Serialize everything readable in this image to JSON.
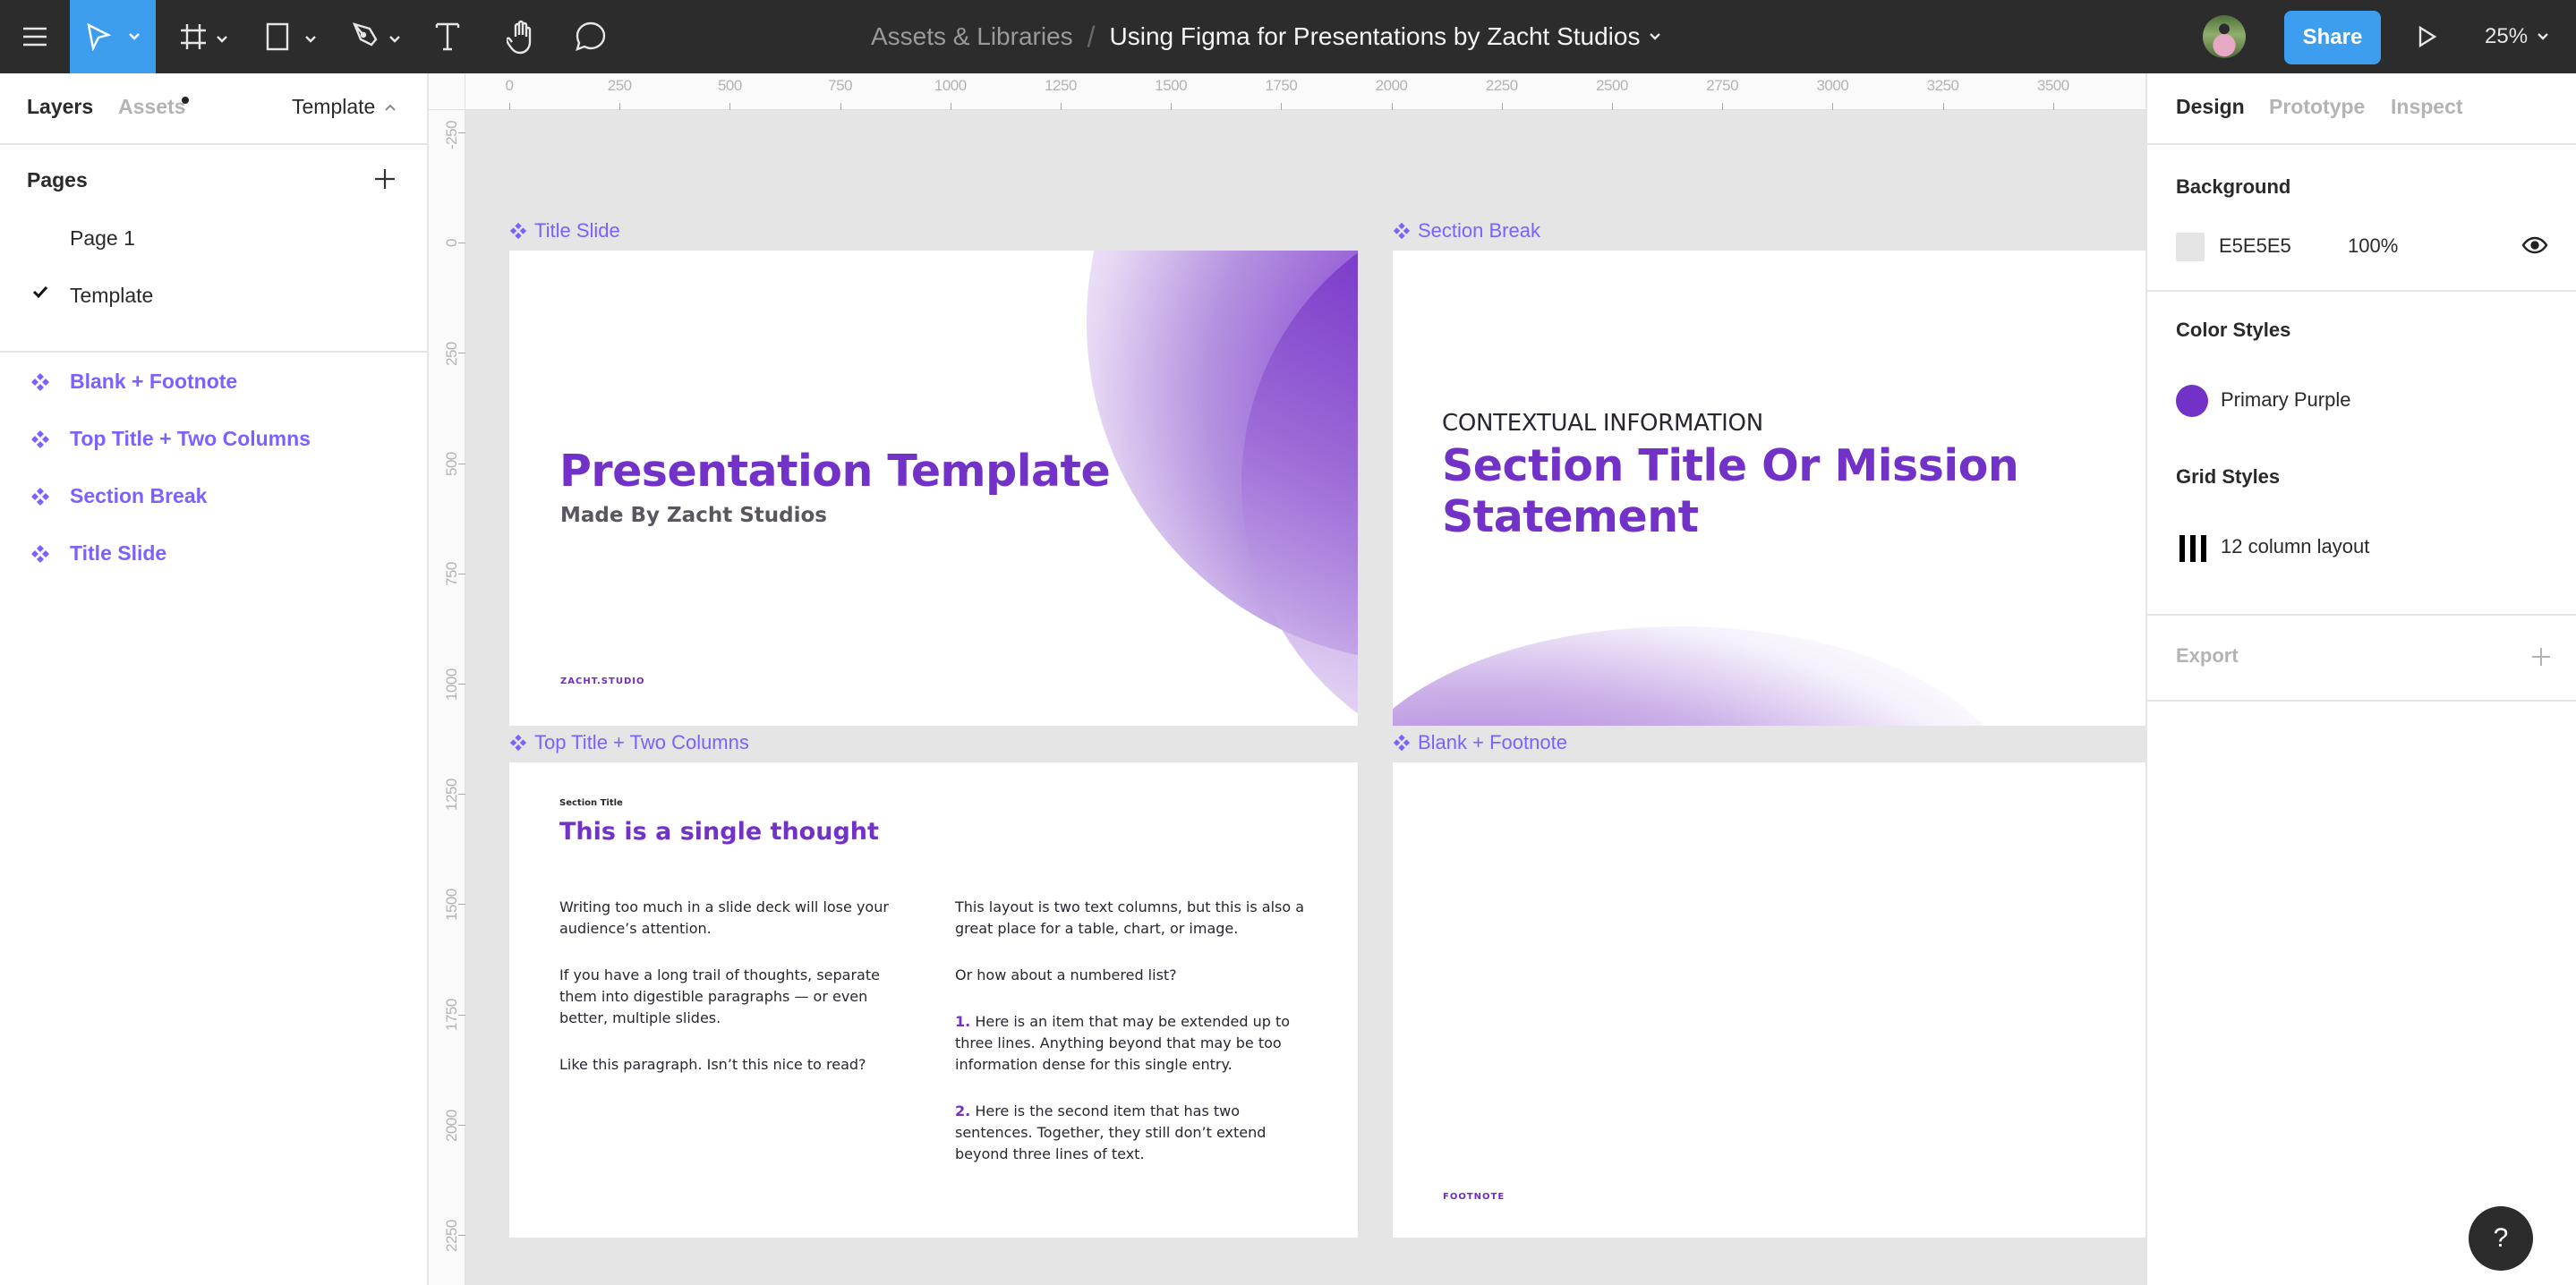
{
  "toolbar": {
    "tools": [
      {
        "name": "main-menu",
        "icon": "hamburger-menu-icon"
      },
      {
        "name": "move-tool",
        "icon": "cursor-arrow-icon",
        "active": true,
        "has_dropdown": true
      },
      {
        "name": "frame-tool",
        "icon": "frame-hash-icon",
        "has_dropdown": true
      },
      {
        "name": "shape-tool",
        "icon": "rectangle-icon",
        "has_dropdown": true
      },
      {
        "name": "pen-tool",
        "icon": "pen-nib-icon",
        "has_dropdown": true
      },
      {
        "name": "text-tool",
        "icon": "text-t-icon"
      },
      {
        "name": "hand-tool",
        "icon": "hand-icon"
      },
      {
        "name": "comment-tool",
        "icon": "speech-bubble-icon"
      }
    ],
    "breadcrumb_parent": "Assets & Libraries",
    "breadcrumb_separator": "/",
    "file_title": "Using Figma for Presentations by Zacht Studios",
    "share_label": "Share",
    "zoom_level": "25%",
    "accent_color": "#3d9ef0"
  },
  "left_panel": {
    "tabs": [
      {
        "label": "Layers",
        "active": true
      },
      {
        "label": "Assets",
        "active": false,
        "has_dot": true
      }
    ],
    "current_page": "Template",
    "pages_header": "Pages",
    "pages": [
      {
        "label": "Page 1",
        "selected": false
      },
      {
        "label": "Template",
        "selected": true
      }
    ],
    "layers": [
      {
        "label": "Blank + Footnote",
        "icon": "component-icon"
      },
      {
        "label": "Top Title + Two Columns",
        "icon": "component-icon"
      },
      {
        "label": "Section Break",
        "icon": "component-icon"
      },
      {
        "label": "Title Slide",
        "icon": "component-icon"
      }
    ],
    "component_color": "#7b61ff"
  },
  "rulers": {
    "top": [
      "0",
      "250",
      "500",
      "750",
      "1000",
      "1250",
      "1500",
      "1750",
      "2000",
      "2250",
      "2500",
      "2750",
      "3000",
      "3250",
      "3500"
    ],
    "left": [
      "-250",
      "0",
      "250",
      "500",
      "750",
      "1000",
      "1250",
      "1500",
      "1750",
      "2000",
      "2250"
    ]
  },
  "canvas": {
    "frames": {
      "title_slide": {
        "label": "Title Slide",
        "title": "Presentation Template",
        "subtitle": "Made By Zacht Studios",
        "footer": "ZACHT.STUDIO"
      },
      "section_break": {
        "label": "Section Break",
        "context": "CONTEXTUAL INFORMATION",
        "title": "Section Title Or Mission Statement"
      },
      "two_columns": {
        "label": "Top Title + Two Columns",
        "section": "Section Title",
        "title": "This is a single thought",
        "left_paragraphs": [
          "Writing too much in a slide deck will lose your audience’s attention.",
          "If you have a long trail of thoughts, separate them into digestible paragraphs — or even better, multiple slides.",
          "Like this paragraph. Isn’t this nice to read?"
        ],
        "right_intro": "This layout is two text columns, but this is also a great place for a table, chart, or image.",
        "right_question": "Or how about a numbered list?",
        "list": [
          {
            "num": "1.",
            "text": "Here is an item that may be extended up to three lines. Anything beyond that may be too information dense for this single entry."
          },
          {
            "num": "2.",
            "text": "Here is the second item that has two sentences. Together, they still don’t extend beyond three lines of text."
          }
        ]
      },
      "blank_footnote": {
        "label": "Blank + Footnote",
        "footnote": "FOOTNOTE"
      }
    },
    "primary_purple": "#7231c7"
  },
  "right_panel": {
    "tabs": [
      {
        "label": "Design",
        "active": true
      },
      {
        "label": "Prototype",
        "active": false
      },
      {
        "label": "Inspect",
        "active": false
      }
    ],
    "background": {
      "title": "Background",
      "hex": "E5E5E5",
      "opacity": "100%"
    },
    "color_styles": {
      "title": "Color Styles",
      "items": [
        {
          "label": "Primary Purple",
          "color": "#7231c7"
        }
      ]
    },
    "grid_styles": {
      "title": "Grid Styles",
      "items": [
        {
          "label": "12 column layout"
        }
      ]
    },
    "export": {
      "title": "Export"
    }
  },
  "help_label": "?"
}
